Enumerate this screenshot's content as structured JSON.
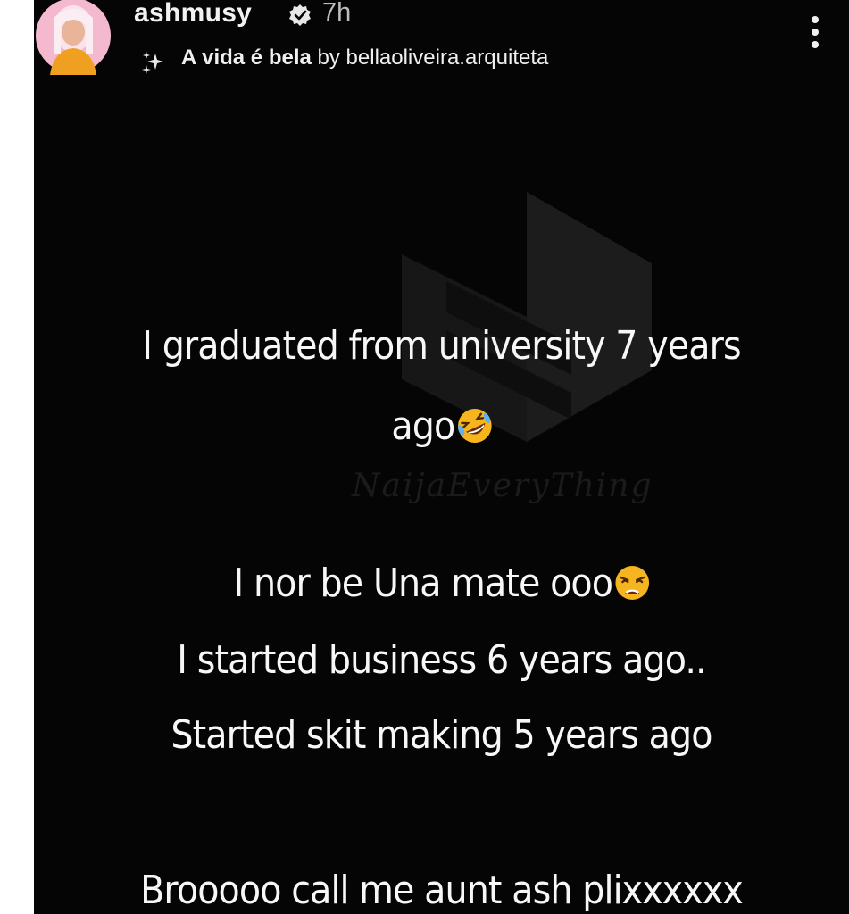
{
  "story": {
    "username": "ashmusy",
    "time": "7h",
    "music": {
      "title": "A vida é bela",
      "by": "by",
      "artist": "bellaoliveira.arquiteta"
    },
    "watermark": "NaijaEveryThing",
    "lines": [
      "I graduated from university 7 years",
      "ago",
      "I nor be Una mate ooo",
      "I started business 6 years ago..",
      "Started skit making 5 years ago",
      "Brooooo call me aunt ash plixxxxxx"
    ]
  },
  "icons": {
    "avatar": "avatar",
    "verified": "verified-badge-icon",
    "sparkle": "sparkle-icon",
    "more": "more-options-icon",
    "emoji1": "rolling-on-floor-laughing-emoji",
    "emoji2": "weary-face-emoji"
  },
  "colors": {
    "background": "#050505",
    "text": "#f7f7f7",
    "emoji": "#f6b51e"
  }
}
